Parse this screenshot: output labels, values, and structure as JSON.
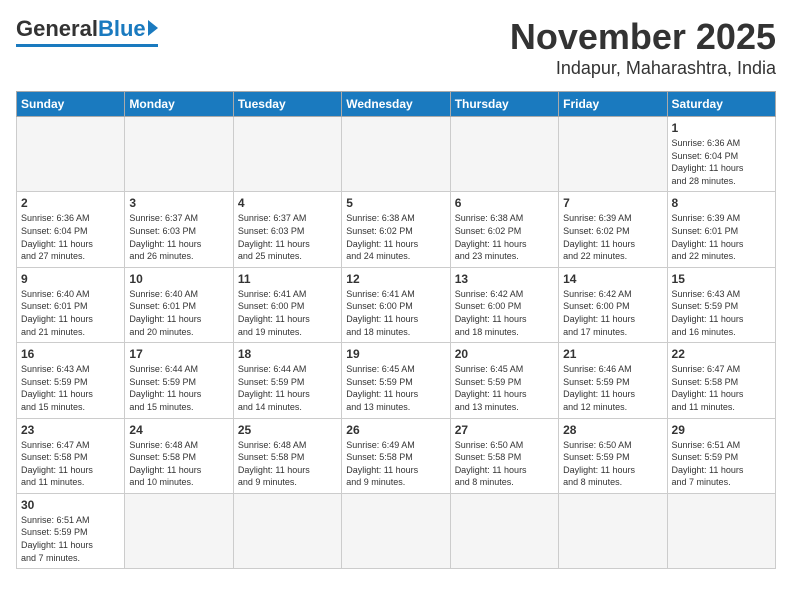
{
  "logo": {
    "general": "General",
    "blue": "Blue"
  },
  "header": {
    "month": "November 2025",
    "location": "Indapur, Maharashtra, India"
  },
  "weekdays": [
    "Sunday",
    "Monday",
    "Tuesday",
    "Wednesday",
    "Thursday",
    "Friday",
    "Saturday"
  ],
  "days": [
    {
      "num": "",
      "info": "",
      "empty": true
    },
    {
      "num": "",
      "info": "",
      "empty": true
    },
    {
      "num": "",
      "info": "",
      "empty": true
    },
    {
      "num": "",
      "info": "",
      "empty": true
    },
    {
      "num": "",
      "info": "",
      "empty": true
    },
    {
      "num": "",
      "info": "",
      "empty": true
    },
    {
      "num": "1",
      "info": "Sunrise: 6:36 AM\nSunset: 6:04 PM\nDaylight: 11 hours\nand 28 minutes."
    },
    {
      "num": "2",
      "info": "Sunrise: 6:36 AM\nSunset: 6:04 PM\nDaylight: 11 hours\nand 27 minutes."
    },
    {
      "num": "3",
      "info": "Sunrise: 6:37 AM\nSunset: 6:03 PM\nDaylight: 11 hours\nand 26 minutes."
    },
    {
      "num": "4",
      "info": "Sunrise: 6:37 AM\nSunset: 6:03 PM\nDaylight: 11 hours\nand 25 minutes."
    },
    {
      "num": "5",
      "info": "Sunrise: 6:38 AM\nSunset: 6:02 PM\nDaylight: 11 hours\nand 24 minutes."
    },
    {
      "num": "6",
      "info": "Sunrise: 6:38 AM\nSunset: 6:02 PM\nDaylight: 11 hours\nand 23 minutes."
    },
    {
      "num": "7",
      "info": "Sunrise: 6:39 AM\nSunset: 6:02 PM\nDaylight: 11 hours\nand 22 minutes."
    },
    {
      "num": "8",
      "info": "Sunrise: 6:39 AM\nSunset: 6:01 PM\nDaylight: 11 hours\nand 22 minutes."
    },
    {
      "num": "9",
      "info": "Sunrise: 6:40 AM\nSunset: 6:01 PM\nDaylight: 11 hours\nand 21 minutes."
    },
    {
      "num": "10",
      "info": "Sunrise: 6:40 AM\nSunset: 6:01 PM\nDaylight: 11 hours\nand 20 minutes."
    },
    {
      "num": "11",
      "info": "Sunrise: 6:41 AM\nSunset: 6:00 PM\nDaylight: 11 hours\nand 19 minutes."
    },
    {
      "num": "12",
      "info": "Sunrise: 6:41 AM\nSunset: 6:00 PM\nDaylight: 11 hours\nand 18 minutes."
    },
    {
      "num": "13",
      "info": "Sunrise: 6:42 AM\nSunset: 6:00 PM\nDaylight: 11 hours\nand 18 minutes."
    },
    {
      "num": "14",
      "info": "Sunrise: 6:42 AM\nSunset: 6:00 PM\nDaylight: 11 hours\nand 17 minutes."
    },
    {
      "num": "15",
      "info": "Sunrise: 6:43 AM\nSunset: 5:59 PM\nDaylight: 11 hours\nand 16 minutes."
    },
    {
      "num": "16",
      "info": "Sunrise: 6:43 AM\nSunset: 5:59 PM\nDaylight: 11 hours\nand 15 minutes."
    },
    {
      "num": "17",
      "info": "Sunrise: 6:44 AM\nSunset: 5:59 PM\nDaylight: 11 hours\nand 15 minutes."
    },
    {
      "num": "18",
      "info": "Sunrise: 6:44 AM\nSunset: 5:59 PM\nDaylight: 11 hours\nand 14 minutes."
    },
    {
      "num": "19",
      "info": "Sunrise: 6:45 AM\nSunset: 5:59 PM\nDaylight: 11 hours\nand 13 minutes."
    },
    {
      "num": "20",
      "info": "Sunrise: 6:45 AM\nSunset: 5:59 PM\nDaylight: 11 hours\nand 13 minutes."
    },
    {
      "num": "21",
      "info": "Sunrise: 6:46 AM\nSunset: 5:59 PM\nDaylight: 11 hours\nand 12 minutes."
    },
    {
      "num": "22",
      "info": "Sunrise: 6:47 AM\nSunset: 5:58 PM\nDaylight: 11 hours\nand 11 minutes."
    },
    {
      "num": "23",
      "info": "Sunrise: 6:47 AM\nSunset: 5:58 PM\nDaylight: 11 hours\nand 11 minutes."
    },
    {
      "num": "24",
      "info": "Sunrise: 6:48 AM\nSunset: 5:58 PM\nDaylight: 11 hours\nand 10 minutes."
    },
    {
      "num": "25",
      "info": "Sunrise: 6:48 AM\nSunset: 5:58 PM\nDaylight: 11 hours\nand 9 minutes."
    },
    {
      "num": "26",
      "info": "Sunrise: 6:49 AM\nSunset: 5:58 PM\nDaylight: 11 hours\nand 9 minutes."
    },
    {
      "num": "27",
      "info": "Sunrise: 6:50 AM\nSunset: 5:58 PM\nDaylight: 11 hours\nand 8 minutes."
    },
    {
      "num": "28",
      "info": "Sunrise: 6:50 AM\nSunset: 5:59 PM\nDaylight: 11 hours\nand 8 minutes."
    },
    {
      "num": "29",
      "info": "Sunrise: 6:51 AM\nSunset: 5:59 PM\nDaylight: 11 hours\nand 7 minutes."
    },
    {
      "num": "30",
      "info": "Sunrise: 6:51 AM\nSunset: 5:59 PM\nDaylight: 11 hours\nand 7 minutes."
    },
    {
      "num": "",
      "info": "",
      "empty": true
    },
    {
      "num": "",
      "info": "",
      "empty": true
    },
    {
      "num": "",
      "info": "",
      "empty": true
    },
    {
      "num": "",
      "info": "",
      "empty": true
    },
    {
      "num": "",
      "info": "",
      "empty": true
    },
    {
      "num": "",
      "info": "",
      "empty": true
    }
  ]
}
